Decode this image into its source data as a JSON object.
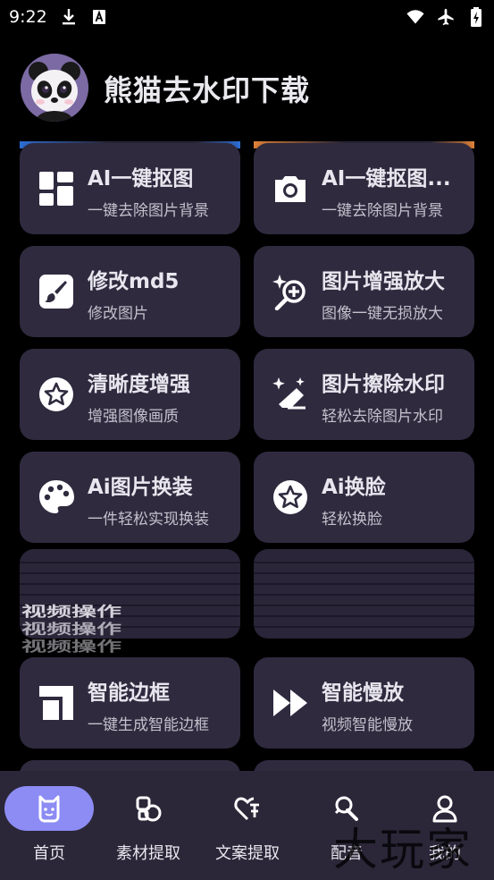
{
  "status_bar": {
    "time": "9:22",
    "left_icons": [
      "download-icon",
      "a-notification-icon"
    ],
    "right_icons": [
      "wifi-icon",
      "airplane-icon",
      "battery-charging-icon"
    ]
  },
  "header": {
    "title": "熊猫去水印下载",
    "avatar_icon": "panda-avatar"
  },
  "cards": [
    {
      "title": "AI一键抠图",
      "subtitle": "一键去除图片背景",
      "icon": "dashboard-icon"
    },
    {
      "title": "AI一键抠图...",
      "subtitle": "一键去除图片背景",
      "icon": "camera-icon"
    },
    {
      "title": "修改md5",
      "subtitle": "修改图片",
      "icon": "brush-icon"
    },
    {
      "title": "图片增强放大",
      "subtitle": "图像一键无损放大",
      "icon": "sparkle-zoom-icon"
    },
    {
      "title": "清晰度增强",
      "subtitle": "增强图像画质",
      "icon": "star-badge-icon"
    },
    {
      "title": "图片擦除水印",
      "subtitle": "轻松去除图片水印",
      "icon": "magic-eraser-icon"
    },
    {
      "title": "Ai图片换装",
      "subtitle": "一件轻松实现换装",
      "icon": "palette-icon"
    },
    {
      "title": "Ai换脸",
      "subtitle": "轻松换脸",
      "icon": "star-badge-icon"
    },
    {
      "title": "智能边框",
      "subtitle": "一键生成智能边框",
      "icon": "border-icon"
    },
    {
      "title": "智能慢放",
      "subtitle": "视频智能慢放",
      "icon": "fast-forward-icon"
    }
  ],
  "glitch_text": "视频操作",
  "nav": [
    {
      "label": "首页",
      "icon": "home-bear-icon",
      "active": true
    },
    {
      "label": "素材提取",
      "icon": "shapes-icon",
      "active": false
    },
    {
      "label": "文案提取",
      "icon": "heart-text-icon",
      "active": false
    },
    {
      "label": "配音",
      "icon": "pen-brush-icon",
      "active": false
    },
    {
      "label": "我的",
      "icon": "person-icon",
      "active": false
    }
  ],
  "watermark": "大玩家",
  "colors": {
    "background": "#000000",
    "card": "#2f2a3e",
    "nav_bar": "#2b2738",
    "nav_active_pill": "#8c8cf4",
    "accent_blue": "#2f6fd6",
    "accent_orange": "#e0823a"
  }
}
